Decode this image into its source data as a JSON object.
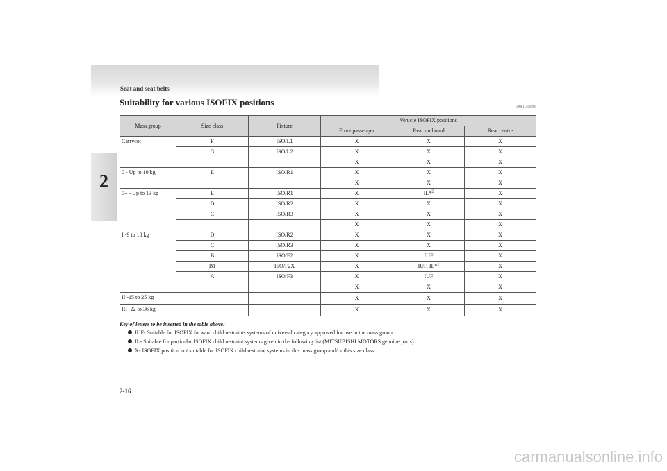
{
  "header": {
    "section_title": "Seat and seat belts",
    "chapter_number": "2"
  },
  "heading": {
    "title": "Suitability for various ISOFIX positions",
    "code": "E00811400269"
  },
  "table": {
    "col_mass": "Mass group",
    "col_size": "Size class",
    "col_fixture": "Fixture",
    "col_vehicle": "Vehicle ISOFIX positions",
    "col_front": "Front passenger",
    "col_rear_out": "Rear outboard",
    "col_rear_ctr": "Rear centre",
    "groups": [
      {
        "mass": "Carrycot",
        "rows": [
          {
            "size": "F",
            "fixture": "ISO/L1",
            "front": "X",
            "rear": "X",
            "centre": "X"
          },
          {
            "size": "G",
            "fixture": "ISO/L2",
            "front": "X",
            "rear": "X",
            "centre": "X"
          },
          {
            "size": "",
            "fixture": "",
            "front": "X",
            "rear": "X",
            "centre": "X"
          }
        ]
      },
      {
        "mass": "0     - Up to 10 kg",
        "rows": [
          {
            "size": "E",
            "fixture": "ISO/R1",
            "front": "X",
            "rear": "X",
            "centre": "X"
          },
          {
            "size": "",
            "fixture": "",
            "front": "X",
            "rear": "X",
            "centre": "X"
          }
        ]
      },
      {
        "mass": "0+   - Up to 13 kg",
        "rows": [
          {
            "size": "E",
            "fixture": "ISO/R1",
            "front": "X",
            "rear": "IL*",
            "rear_sup": "2",
            "centre": "X"
          },
          {
            "size": "D",
            "fixture": "ISO/R2",
            "front": "X",
            "rear": "X",
            "centre": "X"
          },
          {
            "size": "C",
            "fixture": "ISO/R3",
            "front": "X",
            "rear": "X",
            "centre": "X"
          },
          {
            "size": "",
            "fixture": "",
            "front": "X",
            "rear": "X",
            "centre": "X"
          }
        ]
      },
      {
        "mass": "I     -9 to 18 kg",
        "rows": [
          {
            "size": "D",
            "fixture": "ISO/R2",
            "front": "X",
            "rear": "X",
            "centre": "X"
          },
          {
            "size": "C",
            "fixture": "ISO/R3",
            "front": "X",
            "rear": "X",
            "centre": "X"
          },
          {
            "size": "B",
            "fixture": "ISO/F2",
            "front": "X",
            "rear": "IUF",
            "centre": "X"
          },
          {
            "size": "B1",
            "fixture": "ISO/F2X",
            "front": "X",
            "rear": "IUF, IL*",
            "rear_sup": "1",
            "centre": "X"
          },
          {
            "size": "A",
            "fixture": "ISO/F3",
            "front": "X",
            "rear": "IUF",
            "centre": "X"
          },
          {
            "size": "",
            "fixture": "",
            "front": "X",
            "rear": "X",
            "centre": "X"
          }
        ]
      },
      {
        "mass": "II    -15 to 25 kg",
        "rows": [
          {
            "size": "",
            "fixture": "",
            "front": "X",
            "rear": "X",
            "centre": "X"
          }
        ]
      },
      {
        "mass": "III   -22 to 36 kg",
        "rows": [
          {
            "size": "",
            "fixture": "",
            "front": "X",
            "rear": "X",
            "centre": "X"
          }
        ]
      }
    ]
  },
  "key": {
    "title": "Key of letters to be inserted in the table above:",
    "items": [
      "IUF- Suitable for ISOFIX forward child restraints systems of universal category approved for use in the mass group.",
      "IL- Suitable for particular ISOFIX child restraint systems given in the following list (MITSUBISHI MOTORS genuine parts).",
      "X- ISOFIX position not suitable for ISOFIX child restraint systems in this mass group and/or this size class."
    ]
  },
  "footer": {
    "page_number": "2-16",
    "watermark": "carmanualsonline.info"
  }
}
